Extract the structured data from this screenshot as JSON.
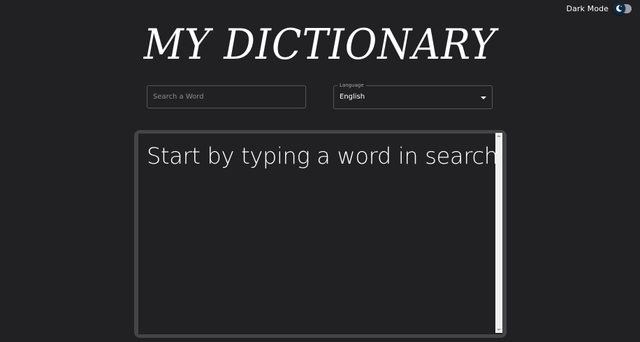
{
  "header": {
    "dark_mode_label": "Dark Mode",
    "dark_mode_enabled": true,
    "toggle_icon": "moon-icon"
  },
  "title": "MY DICTIONARY",
  "search": {
    "placeholder": "Search a Word",
    "value": ""
  },
  "language": {
    "label": "Language",
    "selected": "English"
  },
  "result": {
    "message": "Start by typing a word in search"
  },
  "colors": {
    "background": "#212123",
    "panel_border": "#454547",
    "text": "#ffffff",
    "toggle_thumb": "#0d2a47",
    "toggle_track": "#9e9fa3"
  }
}
